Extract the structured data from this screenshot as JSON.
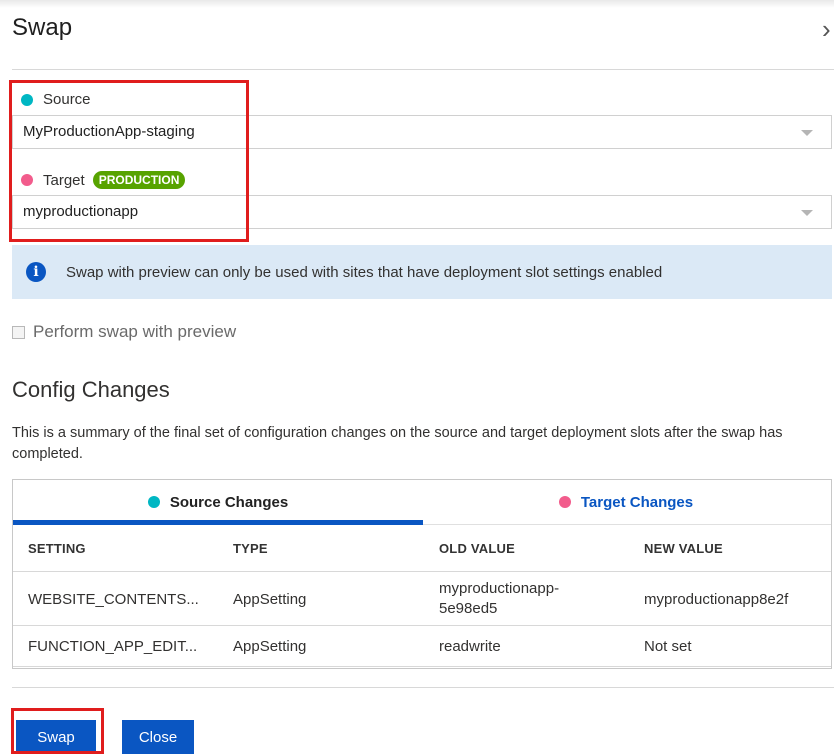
{
  "header": {
    "title": "Swap",
    "close_chevron": "›"
  },
  "source": {
    "label": "Source",
    "dot_color": "#00b7c3",
    "selected": "MyProductionApp-staging"
  },
  "target": {
    "label": "Target",
    "dot_color": "#f25c8c",
    "badge": "PRODUCTION",
    "badge_color": "#57a300",
    "selected": "myproductionapp"
  },
  "info_banner": {
    "icon": "info-icon",
    "text": "Swap with preview can only be used with sites that have deployment slot settings enabled"
  },
  "preview_checkbox": {
    "label": "Perform swap with preview",
    "checked": false
  },
  "config": {
    "title": "Config Changes",
    "description": "This is a summary of the final set of configuration changes on the source and target deployment slots after the swap has completed.",
    "tabs": [
      {
        "label": "Source Changes",
        "active": true
      },
      {
        "label": "Target Changes",
        "active": false
      }
    ],
    "columns": [
      "SETTING",
      "TYPE",
      "OLD VALUE",
      "NEW VALUE"
    ],
    "rows": [
      [
        "WEBSITE_CONTENTS...",
        "AppSetting",
        "myproductionapp-5e98ed5",
        "myproductionapp8e2f"
      ],
      [
        "FUNCTION_APP_EDIT...",
        "AppSetting",
        "readwrite",
        "Not set"
      ]
    ]
  },
  "footer": {
    "swap_label": "Swap",
    "close_label": "Close"
  },
  "colors": {
    "accent": "#0a56c2",
    "highlight": "#e01d1d",
    "info_bg": "#dbe9f6"
  }
}
